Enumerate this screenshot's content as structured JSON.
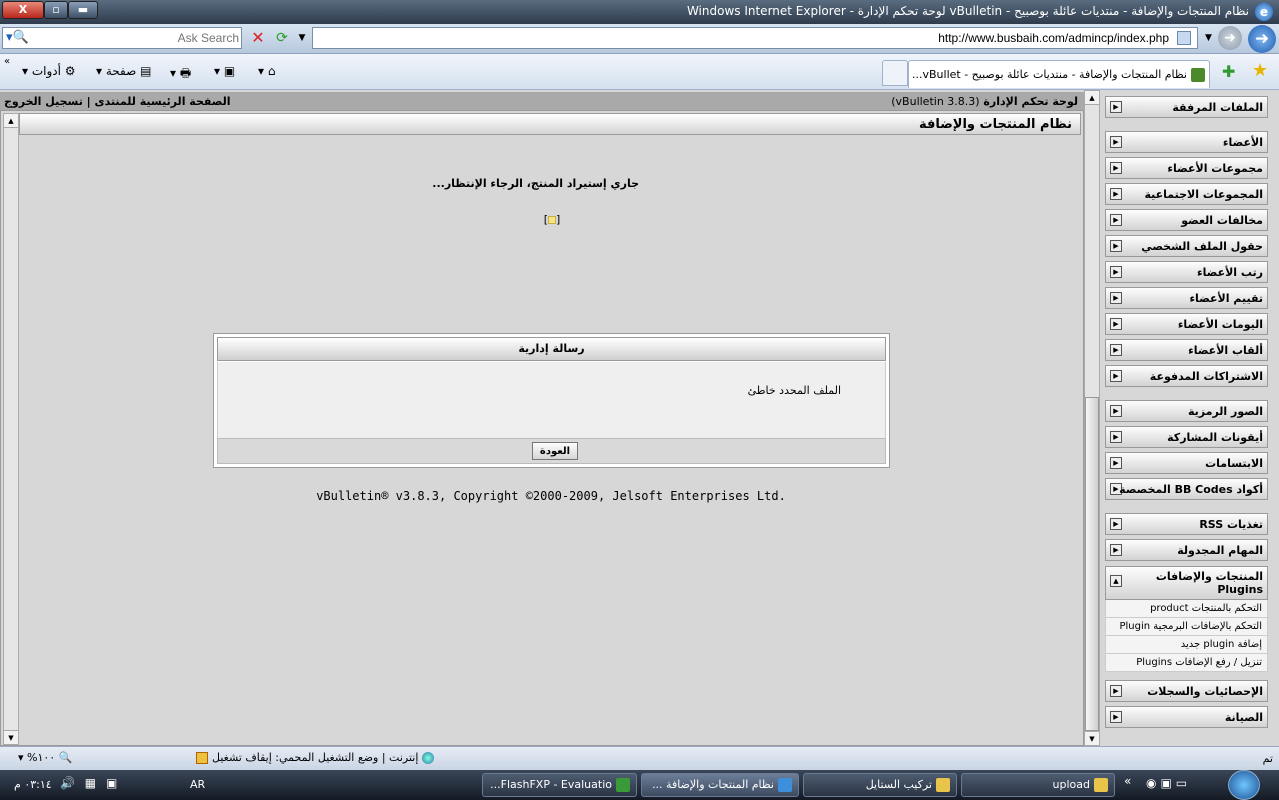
{
  "window": {
    "title": "نظام المنتجات والإضافة - منتديات عائلة بوصبيح - vBulletin لوحة تحكم الإدارة - Windows Internet Explorer",
    "close": "X",
    "maximize": "▫",
    "minimize": "▬"
  },
  "addressbar": {
    "search_placeholder": "Ask Search",
    "url": "http://www.busbaih.com/admincp/index.php"
  },
  "commandbar": {
    "tools": "أدوات ▾",
    "page": "صفحة ▾",
    "print": "▾",
    "feeds": "▾",
    "home": "▾",
    "more": "»",
    "active_tab": "نظام المنتجات والإضافة - منتديات عائلة بوصبيح - vBullet..."
  },
  "topnav": {
    "title": "لوحة تحكم الإدارة",
    "version": "(vBulletin 3.8.3)",
    "links": "الصفحة الرئيسية للمنتدى | تسجيل الخروج"
  },
  "page": {
    "header": "نظام المنتجات والإضافة",
    "loading_bold": "جاري إستيراد المنتج، الرجاء الإنتظار...",
    "loading_icon": "[ ]",
    "message": {
      "title": "رسالة إدارية",
      "text": "الملف المحدد خاطئ",
      "back_button": "العودة"
    },
    "copyright": "vBulletin® v3.8.3, Copyright ©2000-2009, Jelsoft Enterprises Ltd."
  },
  "sidebar": {
    "items": [
      {
        "label": "الملفات المرفقة"
      },
      {
        "label": "الأعضاء"
      },
      {
        "label": "مجموعات الأعضاء"
      },
      {
        "label": "المجموعات الاجتماعية"
      },
      {
        "label": "مخالفات العضو"
      },
      {
        "label": "حقول الملف الشخصي"
      },
      {
        "label": "رتب الأعضاء"
      },
      {
        "label": "تقييم الأعضاء"
      },
      {
        "label": "اليومات الأعضاء"
      },
      {
        "label": "ألقاب الأعضاء"
      },
      {
        "label": "الاشتراكات المدفوعة"
      },
      {
        "label": "الصور الرمزية"
      },
      {
        "label": "أيقونات المشاركة"
      },
      {
        "label": "الابتسامات"
      },
      {
        "label": "أكواد BB Codes المخصصة"
      },
      {
        "label": "تغذيات RSS"
      },
      {
        "label": "المهام المجدولة"
      },
      {
        "label": "الإحصائيات والسجلات"
      },
      {
        "label": "الصيانة"
      }
    ],
    "plugins": {
      "label_line1": "المنتجات والإضافات",
      "label_line2": "Plugins",
      "links": [
        "التحكم بالمنتجات product",
        "التحكم بالإضافات البرمجية Plugin",
        "إضافة plugin جديد",
        "تنزيل / رفع الإضافات Plugins"
      ]
    }
  },
  "statusbar": {
    "done": "تم",
    "zone": "إنترنت | وضع التشغيل المحمي: إيقاف تشغيل",
    "zoom": "▾  %١٠٠"
  },
  "taskbar": {
    "clock": "٠٣:١٤ م",
    "lang": "AR",
    "tray": "🔊",
    "tasks": [
      {
        "label": "upload"
      },
      {
        "label": "تركيب الستايل"
      },
      {
        "label": "نظام المنتجات والإضافة ..."
      },
      {
        "label": "FlashFXP - Evaluatio..."
      }
    ],
    "quicklaunch_chevron": "«"
  }
}
